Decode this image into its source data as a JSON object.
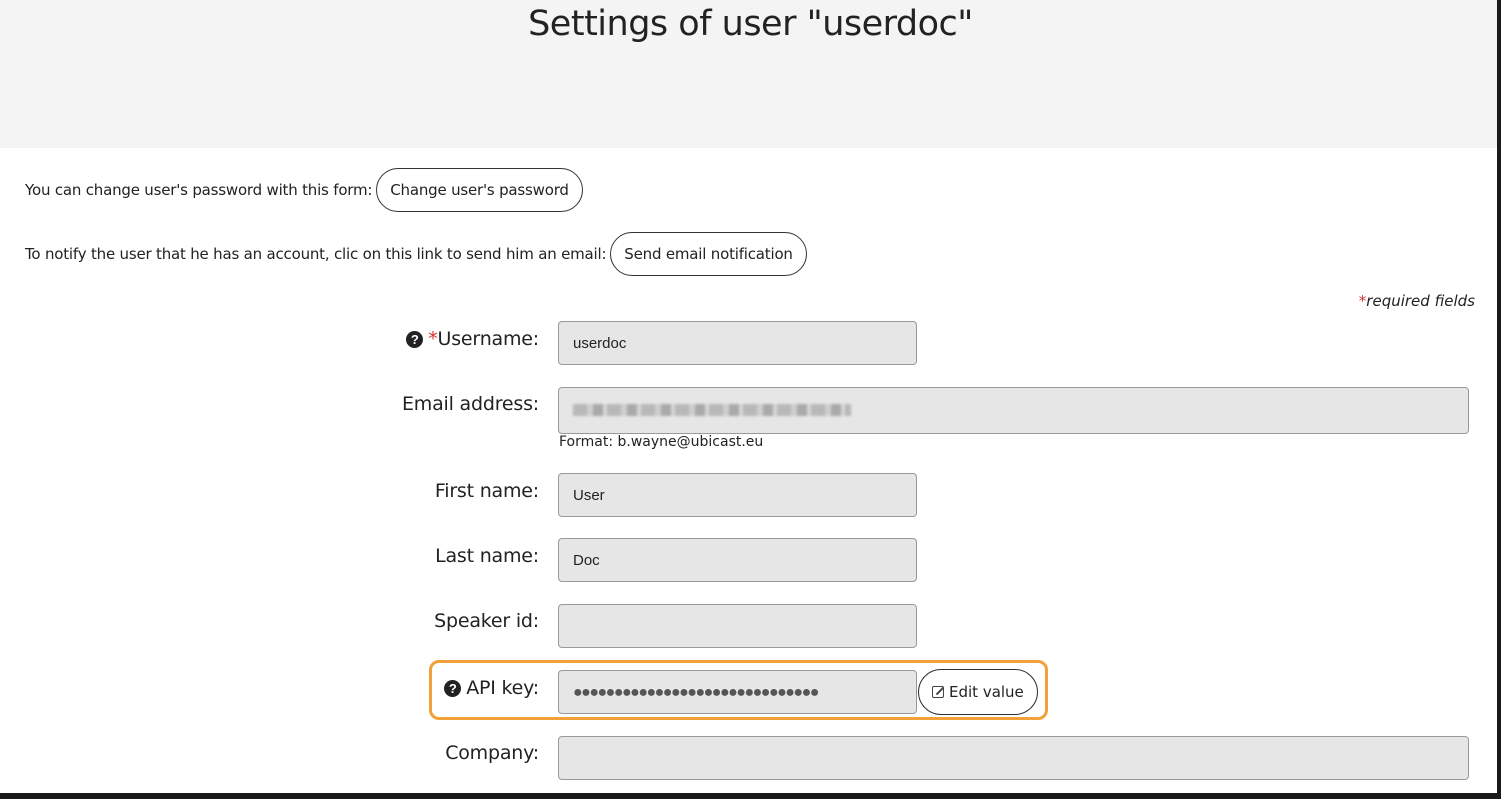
{
  "page": {
    "title": "Settings of user \"userdoc\""
  },
  "password": {
    "text": "You can change user's password with this form:",
    "button_label": "Change user's password"
  },
  "notify": {
    "text": "To notify the user that he has an account, clic on this link to send him an email:",
    "button_label": "Send email notification"
  },
  "required_note": {
    "star": "*",
    "text": "required fields"
  },
  "form": {
    "username": {
      "label": "Username:",
      "star": "*",
      "value": "userdoc"
    },
    "email": {
      "label": "Email address:",
      "value": "",
      "help": "Format: b.wayne@ubicast.eu"
    },
    "first_name": {
      "label": "First name:",
      "value": "User"
    },
    "last_name": {
      "label": "Last name:",
      "value": "Doc"
    },
    "speaker_id": {
      "label": "Speaker id:",
      "value": ""
    },
    "api_key": {
      "label": "API key:",
      "value": "●●●●●●●●●●●●●●●●●●●●●●●●●●●●●●",
      "edit_label": "Edit value"
    },
    "company": {
      "label": "Company:",
      "value": ""
    }
  },
  "colors": {
    "highlight": "#f2a13a",
    "required_star": "#d9302c"
  },
  "icons": {
    "help": "question-circle-icon",
    "edit": "edit-square-icon"
  }
}
